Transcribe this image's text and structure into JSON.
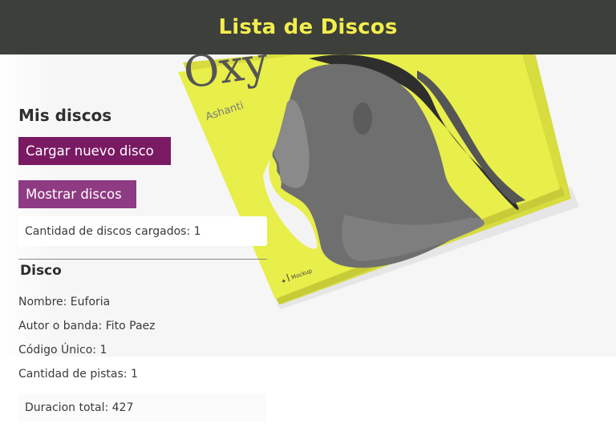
{
  "header": {
    "title": "Lista de Discos"
  },
  "album_art": {
    "title_fragment": "Oxy",
    "artist": "Ashanti",
    "mockup_label": "Mockup",
    "colors": {
      "cover": "#e8ee4a",
      "spine": "#c9cf3c"
    }
  },
  "main": {
    "section_title": "Mis discos",
    "load_button": "Cargar nuevo disco",
    "show_button": "Mostrar discos",
    "count_text": "Cantidad de discos cargados: 1"
  },
  "disc": {
    "heading": "Disco",
    "name": "Nombre: Euforia",
    "author": "Autor o banda: Fito Paez",
    "code": "Código Único: 1",
    "tracks": "Cantidad de pistas: 1",
    "duration": "Duracion total: 427"
  },
  "colors": {
    "header_bg": "#3c3f3a",
    "header_text": "#f2ee4d",
    "load_button_bg": "#7a1a63",
    "show_button_bg": "#8e3b83"
  }
}
